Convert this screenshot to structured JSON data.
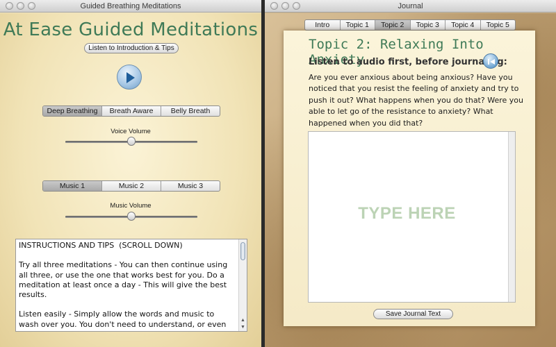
{
  "left_window": {
    "title": "Guided Breathing Meditations",
    "app_title": "At Ease Guided Meditations",
    "intro_button": "Listen to Introduction & Tips",
    "breath_modes": [
      "Deep Breathing",
      "Breath Aware",
      "Belly Breath"
    ],
    "breath_selected": 0,
    "voice_volume_label": "Voice Volume",
    "voice_volume": 0.5,
    "music_options": [
      "Music 1",
      "Music 2",
      "Music 3"
    ],
    "music_selected": 0,
    "music_volume_label": "Music Volume",
    "music_volume": 0.5,
    "instructions": {
      "heading": "INSTRUCTIONS AND TIPS  (SCROLL DOWN)",
      "paragraph1": "Try all three meditations - You can then continue using all three, or use the one that works best for you. Do a meditation at least once a day - This will give the best results.",
      "paragraph2": "Listen easily - Simply allow the words and music to wash over you. You don't need to understand, or even hear, all of the words. They are not instructions that"
    }
  },
  "right_window": {
    "title": "Journal",
    "tabs": [
      "Intro",
      "Topic 1",
      "Topic 2",
      "Topic 3",
      "Topic 4",
      "Topic 5"
    ],
    "tab_selected": 2,
    "topic_title": "Topic 2: Relaxing Into Anxiety",
    "listen_instruction": "Listen to audio first, before journaling:",
    "prompt": "Are you ever anxious about being anxious? Have you noticed that you resist the feeling of anxiety and try to push it out? What happens when you do that? Were you able to let go of the resistance to anxiety? What happened when you did that?",
    "journal_placeholder": "TYPE HERE",
    "save_button": "Save Journal Text"
  },
  "colors": {
    "title_green": "#3f7a57",
    "placeholder_green": "#bcd3b5",
    "parchment": "#f5eac7"
  }
}
